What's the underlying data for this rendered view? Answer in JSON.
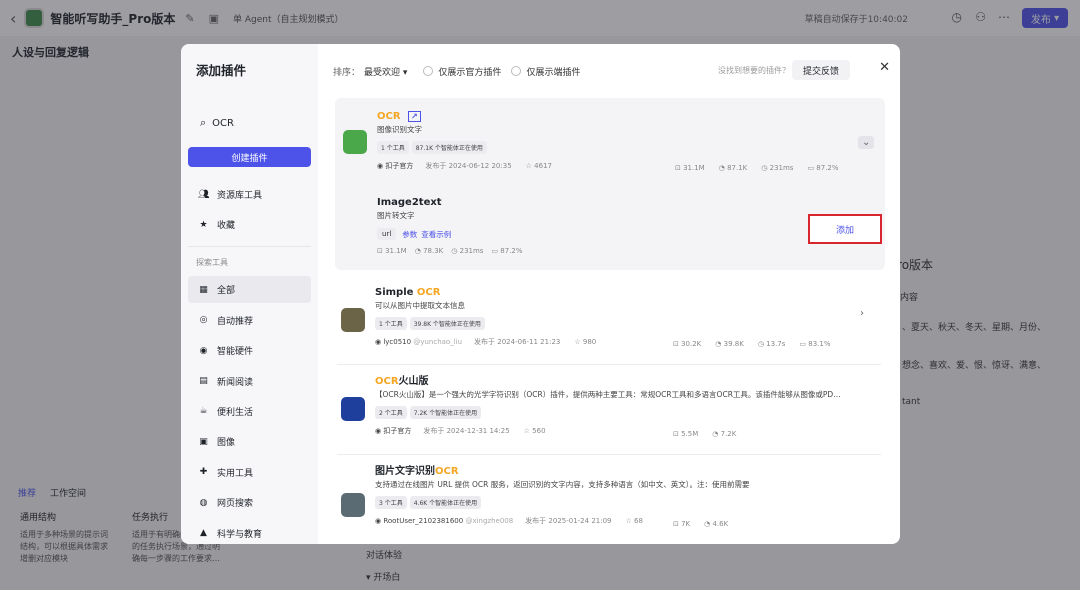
{
  "topbar": {
    "title": "智能听写助手_Pro版本",
    "agent_mode": "单 Agent（自主规划模式）",
    "autosave": "草稿自动保存于10:40:02",
    "publish": "发布"
  },
  "background": {
    "heading": "人设与回复逻辑",
    "tabs": [
      "推荐",
      "工作空间"
    ],
    "cards": [
      {
        "title": "通用结构",
        "text": "适用于多种场景的提示词结构，可以根据具体需求增删对应模块"
      },
      {
        "title": "任务执行",
        "text": "适用于有明确的工作步骤的任务执行场景，通过明确每一步骤的工作要求…"
      }
    ],
    "right_texts": [
      "手_Pro版本",
      "内容",
      "、夏天、秋天、冬天、星期、月份、",
      "想念、喜欢、爱、恨、惊讶、满意、",
      "tant"
    ],
    "bottom_texts": [
      "对话体验",
      "开场白"
    ]
  },
  "modal": {
    "title": "添加插件",
    "search_value": "OCR",
    "create_button": "创建插件",
    "library_items": [
      {
        "icon": "users-icon",
        "label": "资源库工具"
      },
      {
        "icon": "star-icon",
        "label": "收藏"
      }
    ],
    "category_title": "探索工具",
    "categories": [
      {
        "icon": "grid-icon",
        "label": "全部",
        "active": true
      },
      {
        "icon": "auto-icon",
        "label": "自动推荐"
      },
      {
        "icon": "hardware-icon",
        "label": "智能硬件"
      },
      {
        "icon": "news-icon",
        "label": "新闻阅读"
      },
      {
        "icon": "coffee-icon",
        "label": "便利生活"
      },
      {
        "icon": "image-icon",
        "label": "图像"
      },
      {
        "icon": "wrench-icon",
        "label": "实用工具"
      },
      {
        "icon": "globe-icon",
        "label": "网页搜索"
      },
      {
        "icon": "graduation-icon",
        "label": "科学与教育"
      }
    ],
    "sort_label": "排序：",
    "sort_value": "最受欢迎",
    "filter_official": "仅展示官方插件",
    "filter_edge": "仅展示端插件",
    "not_found": "没找到想要的插件？",
    "feedback": "提交反馈"
  },
  "plugins": [
    {
      "name_highlight": "OCR",
      "name_rest": "",
      "desc": "图像识别文字",
      "tags": [
        "1 个工具",
        "87.1K 个智能体正在使用"
      ],
      "author": "扣子官方",
      "published": "发布于 2024-06-12 20:35",
      "favorites": "4617",
      "stats": [
        "31.1M",
        "87.1K",
        "231ms",
        "87.2%"
      ],
      "logo_color": "#4aa84b",
      "tool": {
        "name": "Image2text",
        "desc": "图片转文字",
        "param": "url",
        "params_link": "参数",
        "example_link": "查看示例",
        "stats": [
          "31.1M",
          "78.3K",
          "231ms",
          "87.2%"
        ],
        "add_label": "添加"
      }
    },
    {
      "name_prefix": "Simple ",
      "name_highlight": "OCR",
      "desc": "可以从图片中提取文本信息",
      "tags": [
        "1 个工具",
        "39.8K 个智能体正在使用"
      ],
      "author": "lyc0510",
      "handle": "@yunchao_liu",
      "published": "发布于 2024-06-11 21:23",
      "favorites": "980",
      "stats": [
        "30.2K",
        "39.8K",
        "13.7s",
        "83.1%"
      ],
      "logo_color": "#6b6446"
    },
    {
      "name_highlight": "OCR",
      "name_rest": "火山版",
      "desc": "【OCR火山版】是一个强大的光学字符识别（OCR）插件，提供两种主要工具：常规OCR工具和多语言OCR工具。该插件能够从图像或PD…",
      "tags": [
        "2 个工具",
        "7.2K 个智能体正在使用"
      ],
      "author": "扣子官方",
      "published": "发布于 2024-12-31 14:25",
      "favorites": "560",
      "stats": [
        "5.5M",
        "7.2K"
      ],
      "logo_color": "#1f3f9c"
    },
    {
      "name_prefix": "图片文字识别",
      "name_highlight": "OCR",
      "desc": "支持通过在线图片 URL 提供 OCR 服务，返回识别的文字内容，支持多种语言（如中文、英文）。注：使用前需要",
      "tags": [
        "3 个工具",
        "4.6K 个智能体正在使用"
      ],
      "author": "RootUser_2102381600",
      "handle": "@xingzhe008",
      "published": "发布于 2025-01-24 21:09",
      "favorites": "68",
      "stats": [
        "7K",
        "4.6K"
      ],
      "logo_color": "#5b6b74"
    }
  ]
}
